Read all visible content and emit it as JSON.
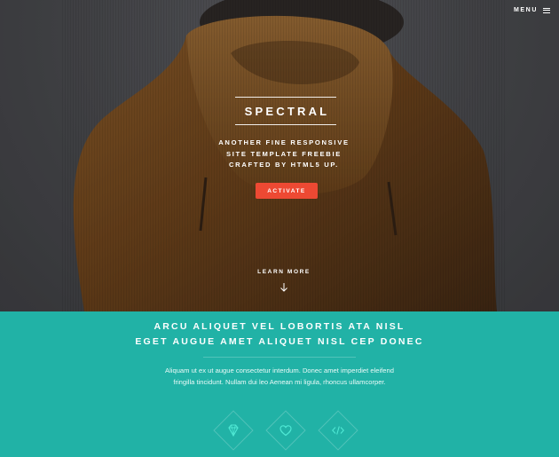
{
  "header": {
    "menu_label": "MENU"
  },
  "banner": {
    "title": "SPECTRAL",
    "tagline_lines": [
      "ANOTHER FINE RESPONSIVE",
      "SITE TEMPLATE FREEBIE",
      "CRAFTED BY HTML5 UP."
    ],
    "activate_label": "ACTIVATE",
    "learn_more_label": "LEARN MORE",
    "activate_color": "#ed4933"
  },
  "intro": {
    "heading_lines": [
      "ARCU ALIQUET VEL LOBORTIS ATA NISL",
      "EGET AUGUE AMET ALIQUET NISL CEP DONEC"
    ],
    "body_lines": [
      "Aliquam ut ex ut augue consectetur interdum. Donec amet imperdiet eleifend",
      "fringilla tincidunt. Nullam dui leo Aenean mi ligula, rhoncus ullamcorper."
    ],
    "background_color": "#21b2a6",
    "icons": [
      "diamond-gem-icon",
      "heart-icon",
      "code-icon"
    ],
    "icon_color": "#4fe8d4"
  }
}
